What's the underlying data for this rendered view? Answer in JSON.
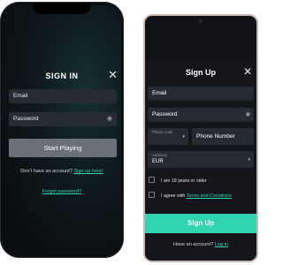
{
  "login": {
    "title": "SIGN IN",
    "close_glyph": "✕",
    "email_placeholder": "Email",
    "password_placeholder": "Password",
    "eye_glyph": "◉",
    "submit_label": "Start Playing",
    "no_account_text": "Don't have an account?",
    "signup_link": "Sign up here!",
    "forgot_link": "Forgot password?"
  },
  "signup": {
    "title": "Sign Up",
    "close_glyph": "✕",
    "email_placeholder": "Email",
    "password_placeholder": "Password",
    "eye_glyph": "◉",
    "phone_code_label": "Phone Code",
    "phone_number_placeholder": "Phone Number",
    "currency_label": "Currency",
    "currency_value": "EUR",
    "chevron_glyph": "▾",
    "age_checkbox_label": "I am 18 years or older",
    "terms_prefix": "I agree with",
    "terms_link": "Terms and Conditions",
    "submit_label": "Sign Up",
    "have_account_text": "Have an account?",
    "login_link": "Log in"
  },
  "colors": {
    "accent": "#30d4b0",
    "link": "#2dd6ad",
    "disabled_button": "#6b6f78",
    "field_bg": "#272b33",
    "screen_bg": "#0f1115"
  }
}
